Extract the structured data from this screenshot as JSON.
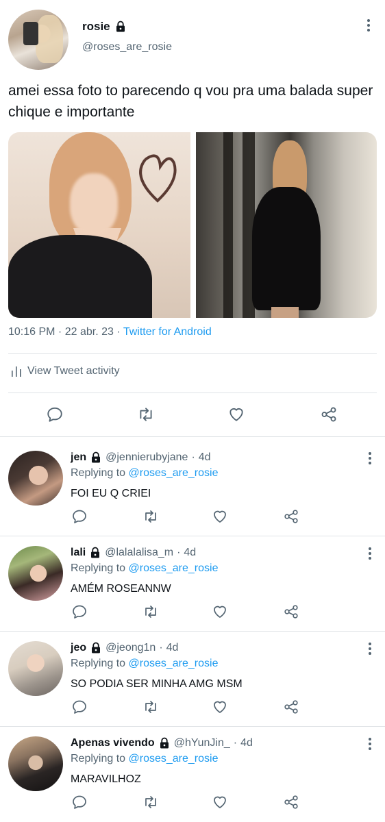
{
  "tweet": {
    "author_name": "rosie",
    "author_handle": "@roses_are_rosie",
    "text": "amei essa foto to parecendo q vou pra uma balada super chique e importante",
    "time": "10:16 PM",
    "date": "22 abr. 23",
    "source": "Twitter for Android",
    "activity_label": "View Tweet activity",
    "media": [
      {
        "name": "photo-left"
      },
      {
        "name": "photo-right"
      }
    ]
  },
  "colors": {
    "accent": "#1d9bf0",
    "text": "#0f1419",
    "secondary": "#536471",
    "divider": "#dfe3e6"
  },
  "icons": {
    "reply": "reply-icon",
    "retweet": "retweet-icon",
    "like": "heart-icon",
    "share": "share-icon",
    "more": "more-icon",
    "lock": "lock-icon",
    "activity": "bar-chart-icon"
  },
  "replies": [
    {
      "name": "jen",
      "handle": "@jennierubyjane",
      "time": "4d",
      "replying_prefix": "Replying to",
      "replying_to": "@roses_are_rosie",
      "text": "FOI EU Q CRIEI"
    },
    {
      "name": "lali",
      "handle": "@lalalalisa_m",
      "time": "4d",
      "replying_prefix": "Replying to",
      "replying_to": "@roses_are_rosie",
      "text": "AMÉM ROSEANNW"
    },
    {
      "name": "jeo",
      "handle": "@jeong1n",
      "time": "4d",
      "replying_prefix": "Replying to",
      "replying_to": "@roses_are_rosie",
      "text": "SO PODIA SER MINHA AMG MSM"
    },
    {
      "name": "Apenas vivendo",
      "handle": "@hYunJin_",
      "time": "4d",
      "replying_prefix": "Replying to",
      "replying_to": "@roses_are_rosie",
      "text": "MARAVILHOZ"
    }
  ]
}
